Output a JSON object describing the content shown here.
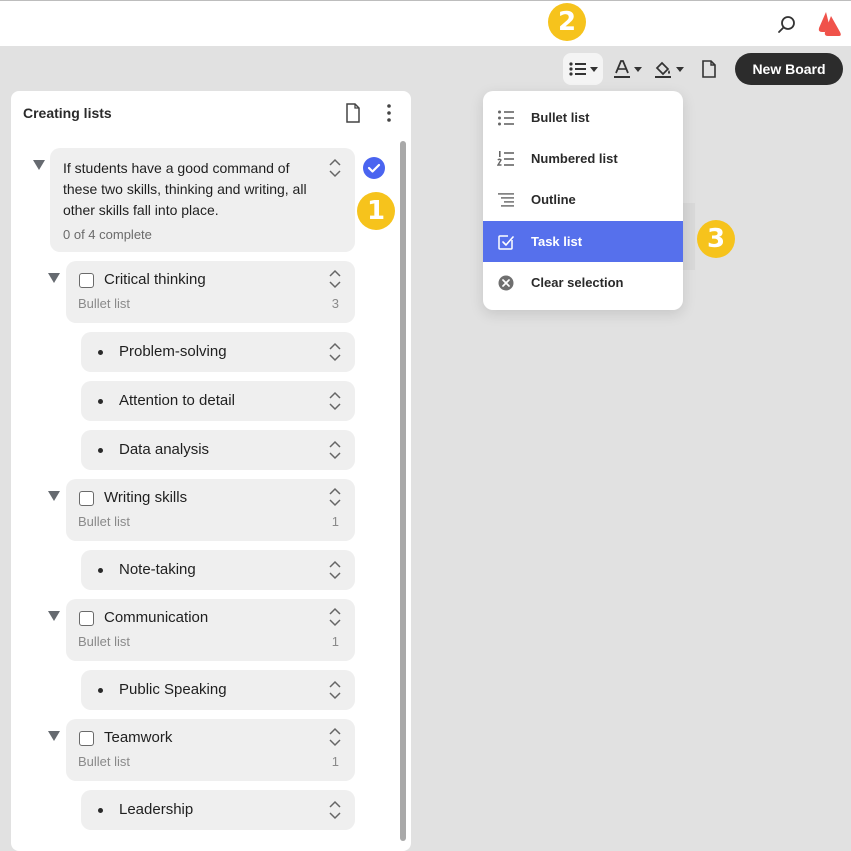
{
  "header": {
    "search_icon": "search-icon",
    "logo_icon": "brand-logo"
  },
  "callouts": {
    "one": "1",
    "two": "2",
    "three": "3"
  },
  "toolbar": {
    "new_board_label": "New Board",
    "icons": [
      "list-style-icon",
      "text-color-icon",
      "fill-color-icon",
      "document-icon"
    ]
  },
  "board": {
    "title": "Creating lists",
    "root": {
      "text": "If students have a good command of these two skills, thinking and writing, all other skills fall into place.",
      "progress": "0 of 4 complete",
      "checked": true
    },
    "groups": [
      {
        "label": "Critical thinking",
        "type": "Bullet list",
        "count": "3",
        "items": [
          "Problem-solving",
          "Attention to detail",
          "Data analysis"
        ]
      },
      {
        "label": "Writing skills",
        "type": "Bullet list",
        "count": "1",
        "items": [
          "Note-taking"
        ]
      },
      {
        "label": "Communication",
        "type": "Bullet list",
        "count": "1",
        "items": [
          "Public Speaking"
        ]
      },
      {
        "label": "Teamwork",
        "type": "Bullet list",
        "count": "1",
        "items": [
          "Leadership"
        ]
      }
    ]
  },
  "menu": {
    "items": [
      {
        "label": "Bullet list",
        "icon": "bullet-list-icon"
      },
      {
        "label": "Numbered list",
        "icon": "numbered-list-icon"
      },
      {
        "label": "Outline",
        "icon": "outline-icon"
      },
      {
        "label": "Task list",
        "icon": "task-list-icon",
        "selected": true
      },
      {
        "label": "Clear selection",
        "icon": "clear-icon"
      }
    ]
  },
  "colors": {
    "accent": "#5670ec",
    "callout": "#f6c31c",
    "check": "#4a64f0",
    "logo": "#f0524a"
  }
}
